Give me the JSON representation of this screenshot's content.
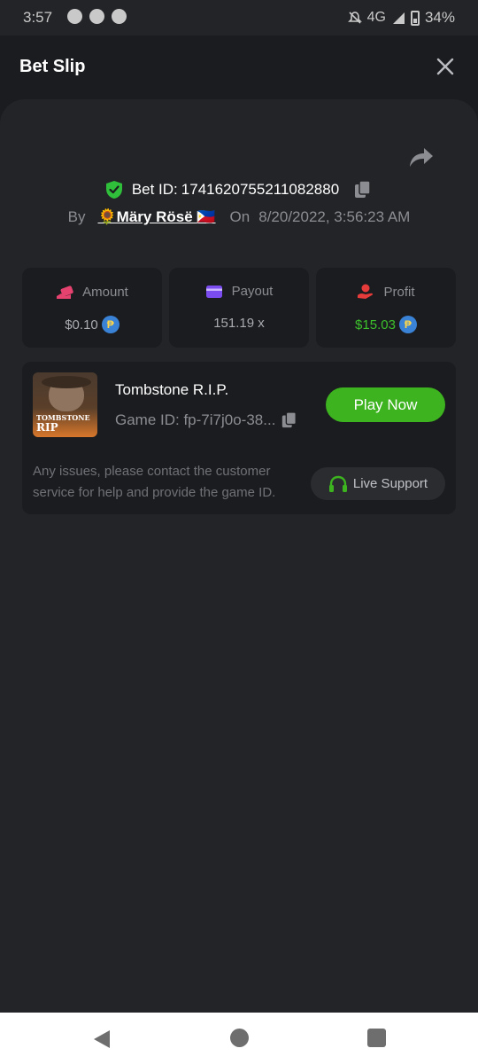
{
  "status_bar": {
    "time": "3:57",
    "network": "4G",
    "battery": "34%"
  },
  "header": {
    "title": "Bet Slip"
  },
  "bet": {
    "id_label": "Bet ID:",
    "id_value": "1741620755211082880",
    "by_label": "By",
    "user": "🌻Märy Rösë 🇵🇭",
    "on_label": "On",
    "date": "8/20/2022, 3:56:23 AM"
  },
  "stats": [
    {
      "label": "Amount",
      "value": "$0.10",
      "color": "#e6426f"
    },
    {
      "label": "Payout",
      "value": "151.19 x",
      "color": "#7b4cf0"
    },
    {
      "label": "Profit",
      "value": "$15.03",
      "color": "#e63b3b"
    }
  ],
  "coin_symbol": "₱",
  "game": {
    "name": "Tombstone R.I.P.",
    "id_text": "Game ID: fp-7i7j0o-38...",
    "thumb_line1": "TOMBSTONE",
    "thumb_line2": "RIP",
    "play_label": "Play Now",
    "help_text": "Any issues, please contact the customer service for help and provide the game ID.",
    "support_label": "Live Support"
  },
  "colors": {
    "accent_green": "#3cb31f",
    "profit_green": "#3cc02c",
    "background": "#1b1c1f",
    "card": "#232427"
  }
}
